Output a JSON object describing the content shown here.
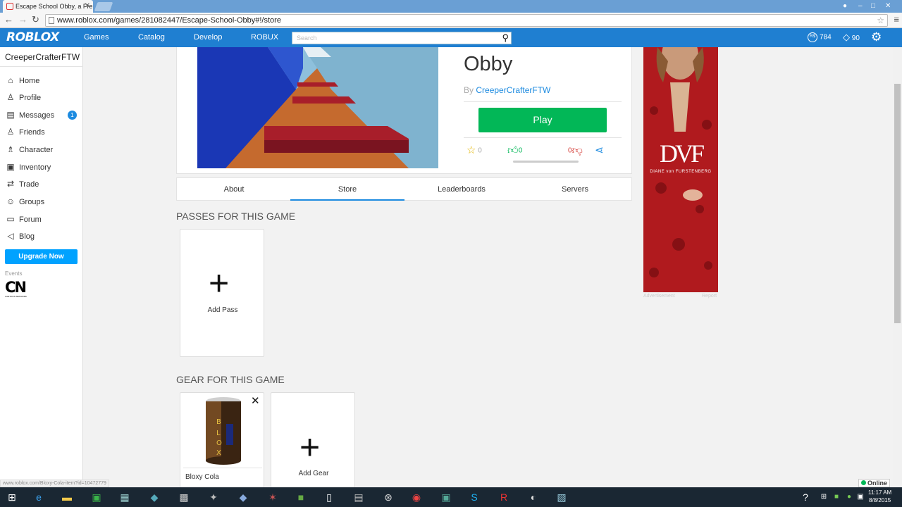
{
  "browser": {
    "tab_title": "Escape School Obby, a Fre",
    "url": "www.roblox.com/games/281082447/Escape-School-Obby#!/store"
  },
  "header": {
    "logo": "ROBLOX",
    "nav": [
      "Games",
      "Catalog",
      "Develop",
      "ROBUX"
    ],
    "search_placeholder": "Search",
    "robux": "784",
    "tickets": "90"
  },
  "sidebar": {
    "username": "CreeperCrafterFTW",
    "items": [
      {
        "label": "Home",
        "icon": "home-icon"
      },
      {
        "label": "Profile",
        "icon": "profile-icon"
      },
      {
        "label": "Messages",
        "icon": "messages-icon",
        "badge": "1"
      },
      {
        "label": "Friends",
        "icon": "friends-icon"
      },
      {
        "label": "Character",
        "icon": "character-icon"
      },
      {
        "label": "Inventory",
        "icon": "inventory-icon"
      },
      {
        "label": "Trade",
        "icon": "trade-icon"
      },
      {
        "label": "Groups",
        "icon": "groups-icon"
      },
      {
        "label": "Forum",
        "icon": "forum-icon"
      },
      {
        "label": "Blog",
        "icon": "blog-icon"
      }
    ],
    "upgrade": "Upgrade Now",
    "events_label": "Events",
    "cn_logo": "CN",
    "cn_sub": "CARTOON NETWORK"
  },
  "game": {
    "title": "Obby",
    "by": "By",
    "creator": "CreeperCrafterFTW",
    "play": "Play",
    "favorites": "0",
    "upvotes": "0",
    "downvotes": "0"
  },
  "tabs": [
    "About",
    "Store",
    "Leaderboards",
    "Servers"
  ],
  "store": {
    "passes_title": "PASSES FOR THIS GAME",
    "add_pass": "Add Pass",
    "gear_title": "GEAR FOR THIS GAME",
    "gear_item": "Bloxy Cola",
    "add_gear": "Add Gear",
    "cola_text": "BLOXY"
  },
  "ad": {
    "brand": "DVF",
    "sub": "DIANE von FURSTENBERG",
    "advertisement": "Advertisement",
    "report": "Report"
  },
  "status": {
    "url": "www.roblox.com/Bloxy-Cola-item?id=10472779",
    "online": "Online"
  },
  "clock": {
    "time": "11:17 AM",
    "date": "8/8/2015"
  }
}
